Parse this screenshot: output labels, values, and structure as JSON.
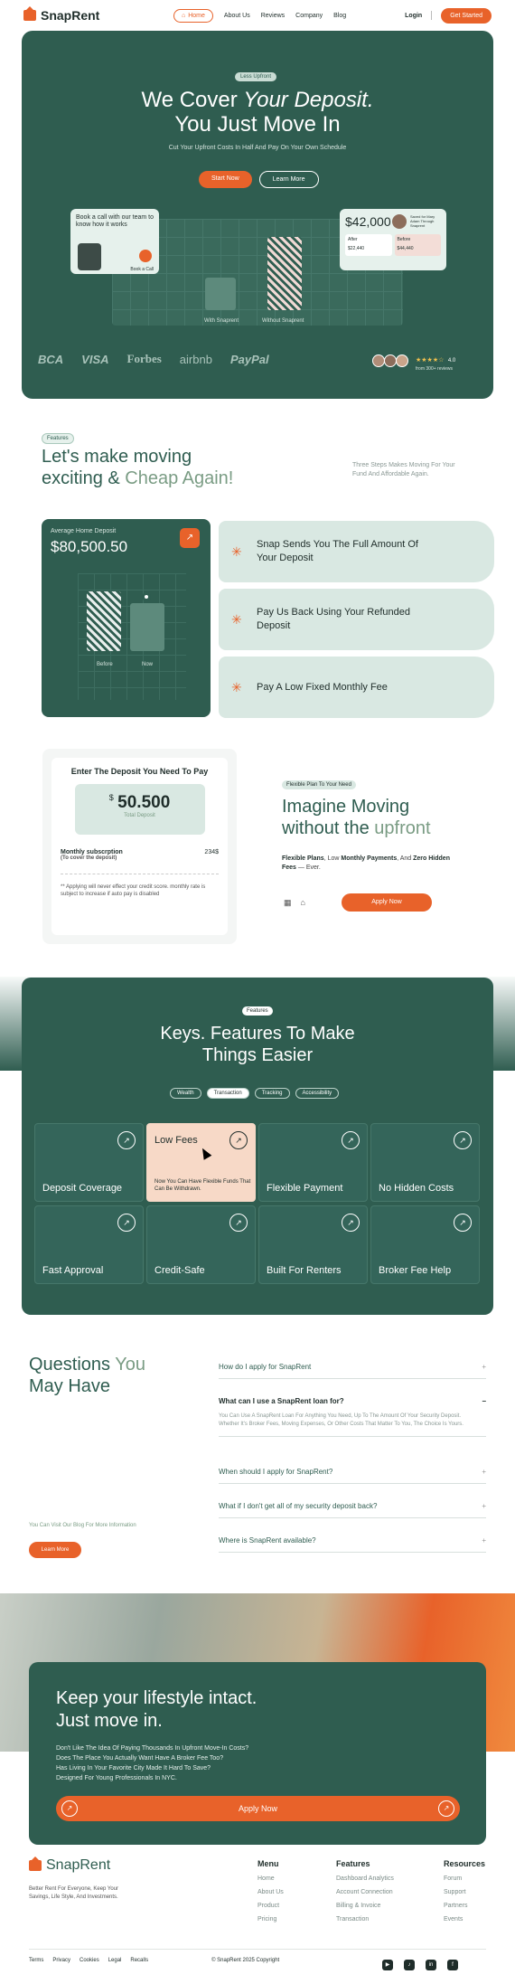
{
  "nav": {
    "brand": "SnapRent",
    "links": [
      "Home",
      "About Us",
      "Reviews",
      "Company",
      "Blog"
    ],
    "login": "Login",
    "get_started": "Get Started"
  },
  "hero": {
    "badge": "Less Upfront",
    "title_1": "We Cover ",
    "title_italic": "Your Deposit.",
    "title_2": "You Just Move In",
    "subtitle": "Cut Your Upfront Costs In Half And Pay On Your Own Schedule",
    "start_now": "Start Now",
    "learn_more": "Learn More",
    "bar_with": "With Snaprent",
    "bar_without": "Without Snaprent",
    "call_card_text": "Book a call with our team to know how it works",
    "call_btn_label": "Book a Call",
    "price_amount": "$42,000",
    "price_small": "Saved for Mary Adam Through Snaprent",
    "after_label": "After",
    "after_value": "$22,440",
    "before_label": "Before",
    "before_value": "$44,440",
    "brands": [
      "BCA",
      "VISA",
      "Forbes",
      "airbnb",
      "PayPal"
    ],
    "rating_score": "4.0",
    "rating_reviews": "from 300+ reviews",
    "stars": "★★★★☆"
  },
  "features": {
    "badge": "Features",
    "title_1": "Let's make moving",
    "title_2": "exciting & ",
    "title_accent": "Cheap Again!",
    "side_text": "Three Steps Makes Moving For Your Fund And Affordable Again.",
    "deposit_label": "Average Home Deposit",
    "deposit_value": "$80,500.50",
    "before": "Before",
    "now": "Now",
    "steps": [
      "Snap Sends You The Full Amount Of Your Deposit",
      "Pay Us Back Using Your Refunded Deposit",
      "Pay A Low Fixed Monthly Fee"
    ]
  },
  "calculator": {
    "title": "Enter The Deposit You Need To Pay",
    "currency": "$",
    "value": "50.500",
    "value_label": "Total Deposit",
    "monthly_label": "Monthly subscrption",
    "monthly_sub": "(To cover the deposit)",
    "monthly_value": "234$",
    "note": "** Applying will never effect your credit score. monthly rate is subject to increase if auto pay is disabled"
  },
  "flexible": {
    "badge": "Flexible Plan To Your Need",
    "title_1": "Imagine Moving",
    "title_2": "without the ",
    "title_accent": "upfront",
    "sub_1": "Flexible Plans",
    "sub_2": ", Low ",
    "sub_3": "Monthly Payments",
    "sub_4": ", And ",
    "sub_5": "Zero Hidden Fees",
    "sub_6": " — Ever.",
    "apply": "Apply Now"
  },
  "keys": {
    "badge": "Features",
    "title_1": "Keys. Features To Make",
    "title_2": "Things Easier",
    "tabs": [
      "Wealth",
      "Transaction",
      "Tracking",
      "Accessibility"
    ],
    "cards": [
      "Deposit Coverage",
      "Low Fees",
      "Flexible Payment",
      "No Hidden Costs",
      "Fast Approval",
      "Credit-Safe",
      "Built For Renters",
      "Broker Fee Help"
    ],
    "low_fees_desc": "Now You Can Have Flexible Funds That Can Be Withdrawn."
  },
  "faq": {
    "title_1": "Questions ",
    "title_accent": "You",
    "title_2": "May Have",
    "blog_text": "You Can Visit Our Blog For More Information",
    "learn_more": "Learn More",
    "items": [
      "How do I apply for SnapRent",
      "What can I use a SnapRent loan for?",
      "When should I apply for SnapRent?",
      "What if I don't get all of my security deposit back?",
      "Where is SnapRent available?"
    ],
    "open_answer": "You Can Use A SnapRent Loan For Anything You Need, Up To The Amount Of Your Security Deposit. Whether It's Broker Fees, Moving Expenses, Or Other Costs That Matter To You, The Choice Is Yours."
  },
  "cta": {
    "title_1": "Keep your lifestyle intact.",
    "title_2": "Just move in.",
    "lines": [
      "Don't Like The Idea Of Paying Thousands In Upfront Move-In Costs?",
      "Does The Place You Actually Want Have A Broker Fee Too?",
      "Has Living In Your Favorite City Made It Hard To Save?",
      "Designed For Young Professionals In NYC."
    ],
    "apply": "Apply Now"
  },
  "footer": {
    "brand": "SnapRent",
    "desc": "Better Rent For Everyone, Keep Your Savings, Life Style, And Investments.",
    "cols": [
      {
        "title": "Menu",
        "items": [
          "Home",
          "About Us",
          "Product",
          "Pricing"
        ]
      },
      {
        "title": "Features",
        "items": [
          "Dashboard Analytics",
          "Account Connection",
          "Billing & Invoice",
          "Transaction"
        ]
      },
      {
        "title": "Resources",
        "items": [
          "Forum",
          "Support",
          "Partners",
          "Events"
        ]
      }
    ],
    "bottom_links": [
      "Terms",
      "Privacy",
      "Cookies",
      "Legal",
      "Recalls"
    ],
    "copyright": "© SnapRent 2025 Copyright"
  },
  "colors": {
    "primary": "#2f5d50",
    "accent": "#e8622a",
    "mint": "#d9e8e2",
    "peach": "#f7d9c7"
  }
}
